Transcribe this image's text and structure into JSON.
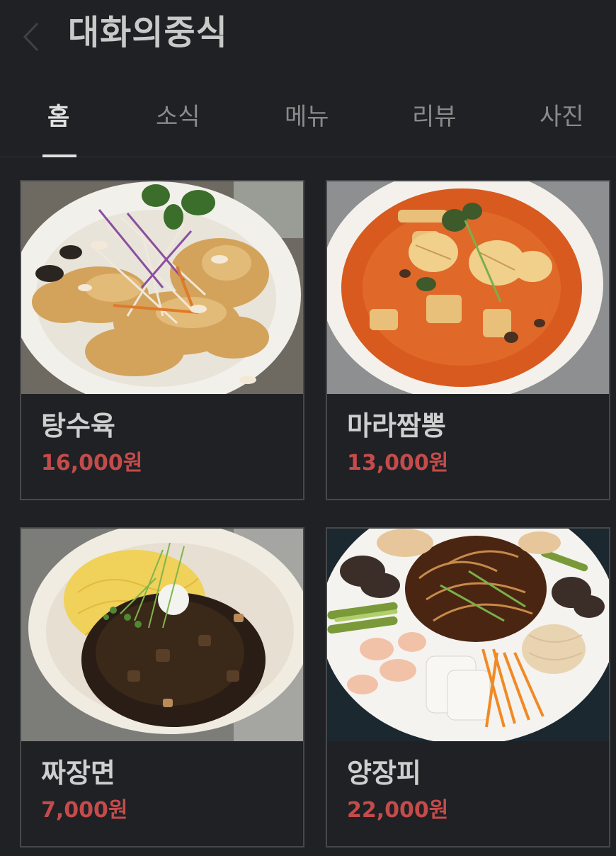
{
  "header": {
    "title": "대화의중식"
  },
  "tabs": [
    {
      "label": "홈",
      "active": true
    },
    {
      "label": "소식",
      "active": false
    },
    {
      "label": "메뉴",
      "active": false
    },
    {
      "label": "리뷰",
      "active": false
    },
    {
      "label": "사진",
      "active": false
    }
  ],
  "menu": [
    {
      "name": "탕수육",
      "price": "16,000원",
      "image": "sweet-and-sour-pork-photo"
    },
    {
      "name": "마라짬뽕",
      "price": "13,000원",
      "image": "mala-jjamppong-photo"
    },
    {
      "name": "짜장면",
      "price": "7,000원",
      "image": "jjajangmyeon-photo"
    },
    {
      "name": "양장피",
      "price": "22,000원",
      "image": "yangjangpi-photo"
    }
  ],
  "colors": {
    "background": "#1f2124",
    "price": "#c54b4b",
    "card_border": "#47484a"
  }
}
